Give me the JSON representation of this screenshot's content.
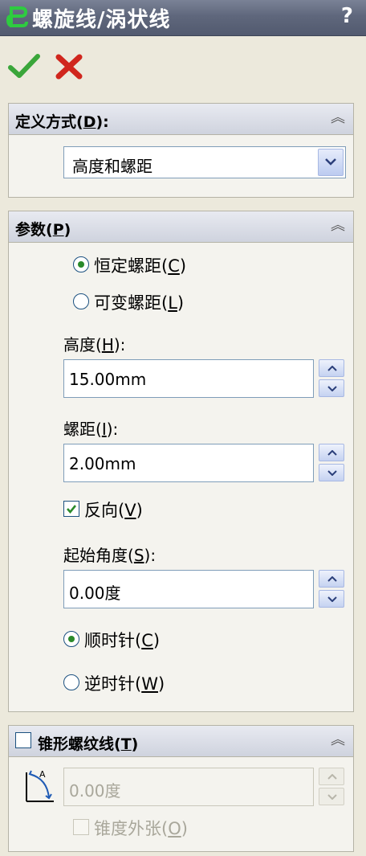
{
  "title": {
    "text": "螺旋线/涡状线",
    "help": "?"
  },
  "actions": {
    "ok": "confirm",
    "cancel": "cancel"
  },
  "definition": {
    "header": "定义方式(",
    "header_key": "D",
    "header_tail": "):",
    "selected": "高度和螺距"
  },
  "params": {
    "header": "参数(",
    "header_key": "P",
    "header_tail": ")",
    "pitch_mode": [
      {
        "label": "恒定螺距(",
        "key": "C",
        "tail": ")",
        "selected": true
      },
      {
        "label": "可变螺距(",
        "key": "L",
        "tail": ")",
        "selected": false
      }
    ],
    "height": {
      "label": "高度(",
      "key": "H",
      "tail": "):",
      "value": "15.00mm"
    },
    "pitch": {
      "label": "螺距(",
      "key": "I",
      "tail": "):",
      "value": "2.00mm"
    },
    "reverse": {
      "label": "反向(",
      "key": "V",
      "tail": ")",
      "checked": true
    },
    "start_angle": {
      "label": "起始角度(",
      "key": "S",
      "tail": "):",
      "value": "0.00度"
    },
    "direction": [
      {
        "label": "顺时针(",
        "key": "C",
        "tail": ")",
        "selected": true
      },
      {
        "label": "逆时针(",
        "key": "W",
        "tail": ")",
        "selected": false
      }
    ]
  },
  "taper": {
    "header": "锥形螺纹线(",
    "header_key": "T",
    "header_tail": ")",
    "enabled": false,
    "angle_value": "0.00度",
    "outward": {
      "label": "锥度外张(",
      "key": "O",
      "tail": ")",
      "checked": false
    }
  },
  "colors": {
    "titlebar": "#5f677c",
    "ok": "#3aa63a",
    "cancel": "#d0261d",
    "check": "#2a8a2a"
  }
}
